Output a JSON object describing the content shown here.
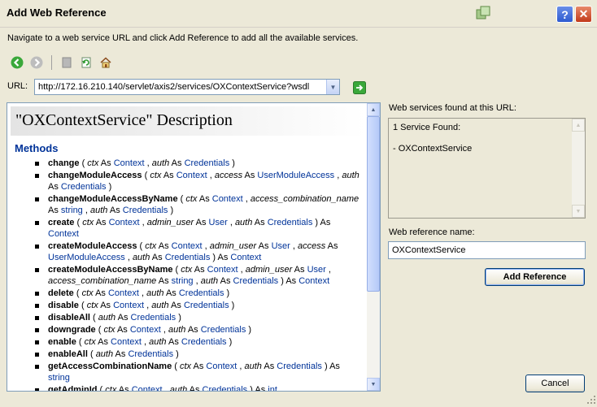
{
  "window": {
    "title": "Add Web Reference"
  },
  "instructions": "Navigate to a web service URL and click Add Reference to add all the available services.",
  "toolbar": {
    "buttons": [
      "back-icon",
      "forward-icon",
      "stop-icon",
      "refresh-icon",
      "home-icon"
    ]
  },
  "url": {
    "label": "URL:",
    "value": "http://172.16.210.140/servlet/axis2/services/OXContextService?wsdl"
  },
  "description": {
    "header": "\"OXContextService\" Description",
    "methods_heading": "Methods",
    "methods": [
      {
        "name": "change",
        "params": [
          [
            "ctx",
            "Context"
          ],
          [
            "auth",
            "Credentials"
          ]
        ],
        "returns": ""
      },
      {
        "name": "changeModuleAccess",
        "params": [
          [
            "ctx",
            "Context"
          ],
          [
            "access",
            "UserModuleAccess"
          ],
          [
            "auth",
            "Credentials"
          ]
        ],
        "returns": ""
      },
      {
        "name": "changeModuleAccessByName",
        "params": [
          [
            "ctx",
            "Context"
          ],
          [
            "access_combination_name",
            "string"
          ],
          [
            "auth",
            "Credentials"
          ]
        ],
        "returns": ""
      },
      {
        "name": "create",
        "params": [
          [
            "ctx",
            "Context"
          ],
          [
            "admin_user",
            "User"
          ],
          [
            "auth",
            "Credentials"
          ]
        ],
        "returns": "Context"
      },
      {
        "name": "createModuleAccess",
        "params": [
          [
            "ctx",
            "Context"
          ],
          [
            "admin_user",
            "User"
          ],
          [
            "access",
            "UserModuleAccess"
          ],
          [
            "auth",
            "Credentials"
          ]
        ],
        "returns": "Context"
      },
      {
        "name": "createModuleAccessByName",
        "params": [
          [
            "ctx",
            "Context"
          ],
          [
            "admin_user",
            "User"
          ],
          [
            "access_combination_name",
            "string"
          ],
          [
            "auth",
            "Credentials"
          ]
        ],
        "returns": "Context"
      },
      {
        "name": "delete",
        "params": [
          [
            "ctx",
            "Context"
          ],
          [
            "auth",
            "Credentials"
          ]
        ],
        "returns": ""
      },
      {
        "name": "disable",
        "params": [
          [
            "ctx",
            "Context"
          ],
          [
            "auth",
            "Credentials"
          ]
        ],
        "returns": ""
      },
      {
        "name": "disableAll",
        "params": [
          [
            "auth",
            "Credentials"
          ]
        ],
        "returns": ""
      },
      {
        "name": "downgrade",
        "params": [
          [
            "ctx",
            "Context"
          ],
          [
            "auth",
            "Credentials"
          ]
        ],
        "returns": ""
      },
      {
        "name": "enable",
        "params": [
          [
            "ctx",
            "Context"
          ],
          [
            "auth",
            "Credentials"
          ]
        ],
        "returns": ""
      },
      {
        "name": "enableAll",
        "params": [
          [
            "auth",
            "Credentials"
          ]
        ],
        "returns": ""
      },
      {
        "name": "getAccessCombinationName",
        "params": [
          [
            "ctx",
            "Context"
          ],
          [
            "auth",
            "Credentials"
          ]
        ],
        "returns": "string"
      },
      {
        "name": "getAdminId",
        "params": [
          [
            "ctx",
            "Context"
          ],
          [
            "auth",
            "Credentials"
          ]
        ],
        "returns": "int"
      }
    ],
    "keyword_as": "As"
  },
  "services": {
    "label": "Web services found at this URL:",
    "count_text": "1 Service Found:",
    "items": [
      "- OXContextService"
    ]
  },
  "reference": {
    "label": "Web reference name:",
    "value": "OXContextService"
  },
  "buttons": {
    "add_reference": "Add Reference",
    "cancel": "Cancel"
  },
  "colors": {
    "window_bg": "#ece9d8",
    "link_blue": "#003399",
    "xp_blue_border": "#003c74"
  }
}
